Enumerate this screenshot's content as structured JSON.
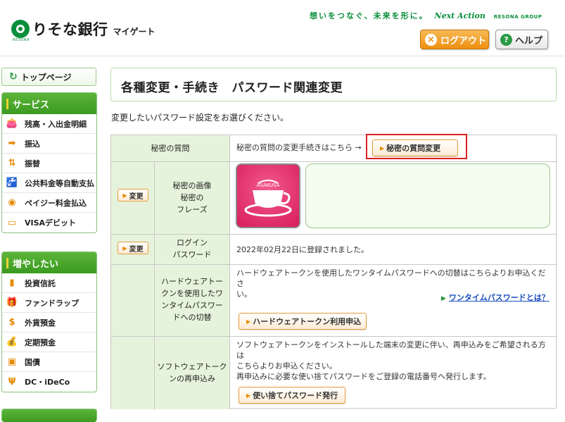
{
  "header": {
    "bank_name": "りそな銀行",
    "service_name": "マイゲート",
    "logo_small": "RESONA",
    "slogan": "想いをつなぐ、未来を形に。",
    "slogan_brand": "Next Action",
    "group_name": "RESONA GROUP",
    "logout_label": "ログアウト",
    "help_label": "ヘルプ",
    "logout_icon": "×",
    "help_icon": "?"
  },
  "sidebar": {
    "top_page": "トップページ",
    "sections": [
      {
        "title": "サービス",
        "items": [
          {
            "label": "残高・入出金明細",
            "icon": "wallet-icon"
          },
          {
            "label": "振込",
            "icon": "transfer-icon"
          },
          {
            "label": "振替",
            "icon": "exchange-icon"
          },
          {
            "label": "公共料金等自動支払",
            "icon": "faucet-icon"
          },
          {
            "label": "ペイジー料金払込",
            "icon": "payeasy-icon"
          },
          {
            "label": "VISAデビット",
            "icon": "debit-card-icon"
          }
        ]
      },
      {
        "title": "増やしたい",
        "items": [
          {
            "label": "投資信託",
            "icon": "bar-chart-icon"
          },
          {
            "label": "ファンドラップ",
            "icon": "gift-icon"
          },
          {
            "label": "外貨預金",
            "icon": "dollar-icon"
          },
          {
            "label": "定期預金",
            "icon": "money-bag-icon"
          },
          {
            "label": "国債",
            "icon": "bond-icon"
          },
          {
            "label": "DC・iDeCo",
            "icon": "sprout-icon"
          }
        ]
      }
    ]
  },
  "main": {
    "title": "各種変更・手続き　パスワード関連変更",
    "instruction": "変更したいパスワード設定をお選びください。",
    "rows": {
      "secret_question": {
        "label": "秘密の質問",
        "text": "秘密の質問の変更手続きはこちら →",
        "button": "秘密の質問変更"
      },
      "secret_image": {
        "change_button": "変更",
        "label_lines": [
          "秘密の画像",
          "秘密の",
          "フレーズ"
        ],
        "image_text": "ASAKUSA"
      },
      "login_password": {
        "change_button": "変更",
        "label_lines": [
          "ログイン",
          "パスワード"
        ],
        "text": "2022年02月22日に登録されました。"
      },
      "hardware_token": {
        "label_lines": [
          "ハードウェアトー",
          "クンを使用したワ",
          "ンタイムパスワー",
          "ドへの切替"
        ],
        "text_lines": [
          "ハードウェアトークンを使用したワンタイムパスワードへの切替はこちらよりお申込くださ",
          "い。"
        ],
        "link": "ワンタイムパスワードとは？",
        "button": "ハードウェアトークン利用申込"
      },
      "software_token": {
        "label_lines": [
          "ソフトウェアトーク",
          "ンの再申込み"
        ],
        "text_lines": [
          "ソフトウェアトークンをインストールした端末の変更に伴い、再申込みをご希望される方は",
          "こちらよりお申込ください。",
          "再申込みに必要な使い捨てパスワードをご登録の電話番号へ発行します。"
        ],
        "button": "使い捨てパスワード発行"
      }
    }
  }
}
